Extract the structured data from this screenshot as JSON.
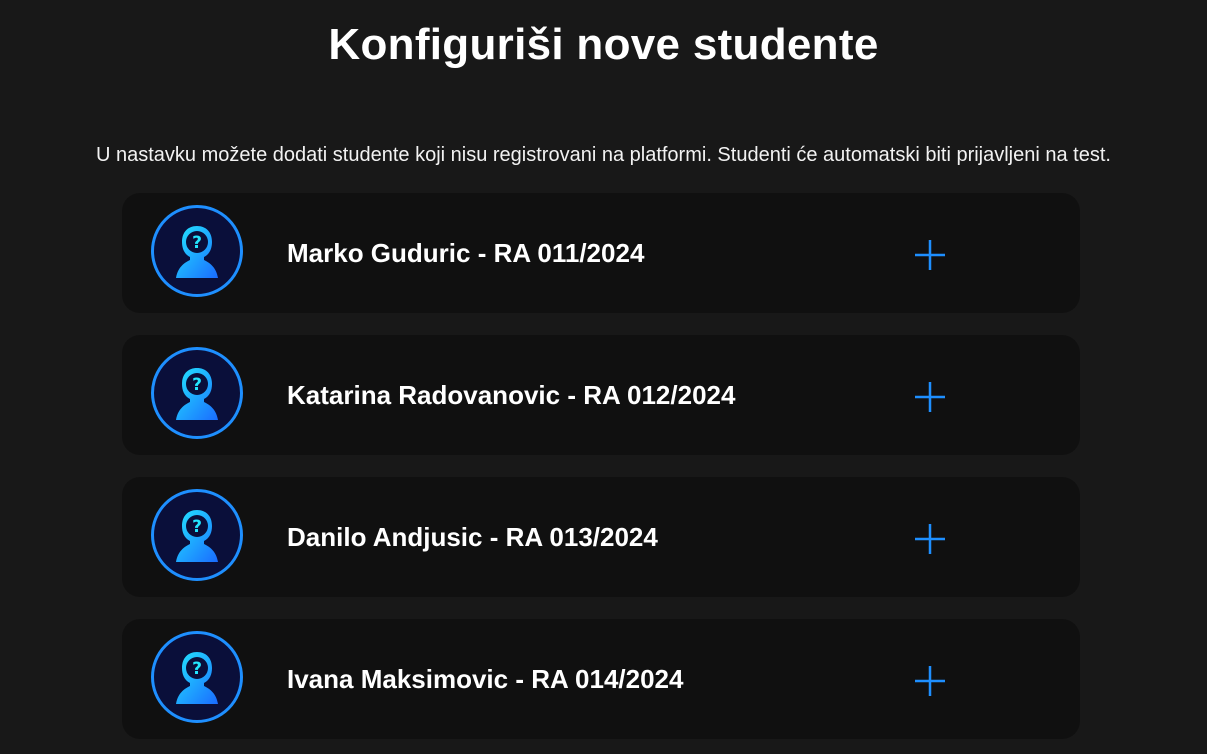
{
  "header": {
    "title": "Konfiguriši nove studente",
    "description": "U nastavku možete dodati studente koji nisu registrovani na platformi. Studenti će automatski biti prijavljeni na test."
  },
  "students": [
    {
      "label": "Marko Guduric - RA 011/2024",
      "avatar_icon": "unknown-user-icon",
      "action_icon": "plus-icon"
    },
    {
      "label": "Katarina Radovanovic - RA 012/2024",
      "avatar_icon": "unknown-user-icon",
      "action_icon": "plus-icon"
    },
    {
      "label": "Danilo Andjusic - RA 013/2024",
      "avatar_icon": "unknown-user-icon",
      "action_icon": "plus-icon"
    },
    {
      "label": "Ivana Maksimovic - RA 014/2024",
      "avatar_icon": "unknown-user-icon",
      "action_icon": "plus-icon"
    }
  ],
  "colors": {
    "background": "#181818",
    "card": "#101010",
    "accent": "#1e8fff",
    "avatar_bg": "#0a0f3a",
    "text": "#ffffff"
  }
}
